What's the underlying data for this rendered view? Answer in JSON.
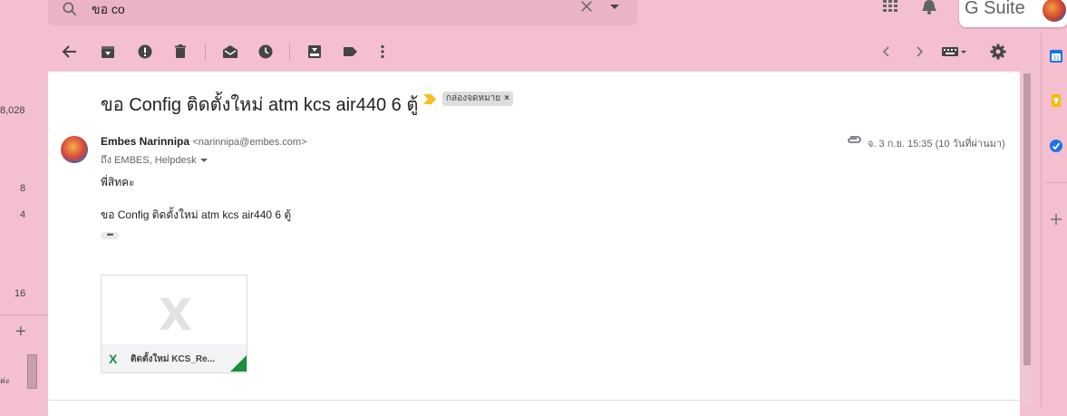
{
  "search": {
    "query": "ขอ co"
  },
  "gsuite": {
    "label": "G Suite"
  },
  "left_strip": {
    "counts": [
      "8,028",
      "8",
      "4",
      "16"
    ],
    "bottom_label": "ค่ะ"
  },
  "email": {
    "subject": "ขอ Config ติดตั้งใหม่ atm kcs air440 6 ตู้",
    "label": "กล่องจดหมาย",
    "sender_name": "Embes Narinnipa",
    "sender_email": "<narinnipa@embes.com>",
    "to": "ถึง EMBES, Helpdesk",
    "date": "จ. 3 ก.ย. 15:35 (10 วันที่ผ่านมา)",
    "body_line1": "พี่สิทคะ",
    "body_line2": "ขอ Config ติดตั้งใหม่ atm kcs air440 6 ตู้",
    "more": "•••",
    "attachment": {
      "icon_text": "X",
      "filename": "ติดตั้งใหม่ KCS_Re..."
    }
  },
  "icons": {
    "toolbar": [
      "back-icon",
      "archive-icon",
      "report-spam-icon",
      "delete-icon",
      "mark-unread-icon",
      "snooze-icon",
      "move-to-icon",
      "labels-icon",
      "more-vert-icon"
    ],
    "right_toolbar": [
      "prev-icon",
      "next-icon",
      "keyboard-icon",
      "settings-icon"
    ],
    "side_panel": [
      "calendar-icon",
      "keep-icon",
      "tasks-icon",
      "add-icon"
    ]
  },
  "colors": {
    "background": "#f4bfcf",
    "card": "#ffffff",
    "accent_label_arrow": "#f6c026",
    "excel_green": "#1e8e3e"
  }
}
